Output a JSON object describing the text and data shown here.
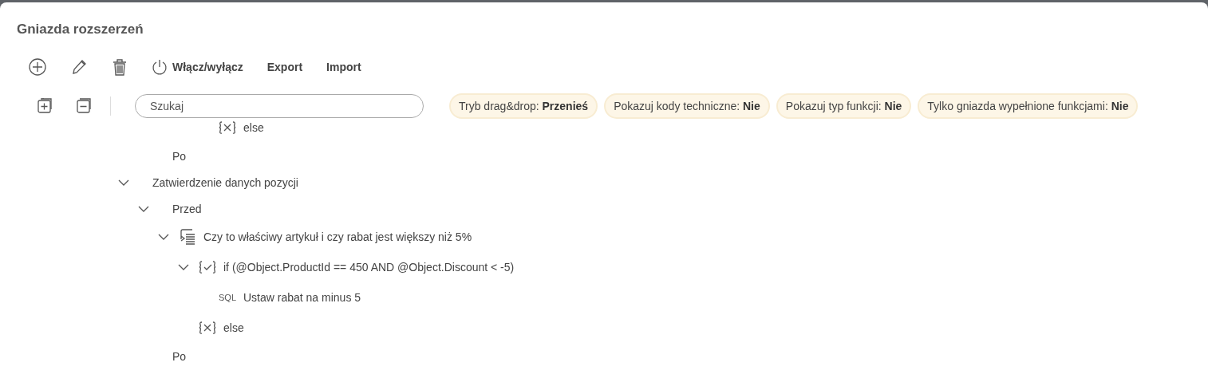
{
  "window": {
    "title": "Gniazda rozszerzeń"
  },
  "toolbar": [
    {
      "kind": "add"
    },
    {
      "kind": "edit"
    },
    {
      "kind": "delete"
    },
    {
      "kind": "power",
      "label": "Włącz/wyłącz"
    },
    {
      "kind": "text",
      "label": "Export"
    },
    {
      "kind": "text",
      "label": "Import"
    }
  ],
  "tree_tools": [
    {
      "kind": "expand-all"
    },
    {
      "kind": "collapse-all"
    }
  ],
  "search": {
    "placeholder": "Szukaj"
  },
  "filters": [
    {
      "label": "Tryb drag&drop:",
      "value": "Przenieś"
    },
    {
      "label": "Pokazuj kody techniczne:",
      "value": "Nie"
    },
    {
      "label": "Pokazuj typ funkcji:",
      "value": "Nie"
    },
    {
      "label": "Tylko gniazda wypełnione funkcjami:",
      "value": "Nie"
    }
  ],
  "tree": [
    {
      "children": [
        {
          "children": [
            {
              "children": [
                {
                  "children": [
                    {
                      "kind": "else",
                      "label": "else"
                    }
                  ]
                }
              ]
            }
          ]
        },
        {
          "label": "Po"
        }
      ]
    },
    {
      "label": "Zatwierdzenie danych pozycji",
      "expanded": true,
      "children": [
        {
          "label": "Przed",
          "expanded": true,
          "children": [
            {
              "kind": "function",
              "label": "Czy to właściwy artykuł i czy rabat jest większy niż 5%",
              "expanded": true,
              "children": [
                {
                  "kind": "if",
                  "label": "if (@Object.ProductId == 450 AND @Object.Discount < -5)",
                  "expanded": true,
                  "children": [
                    {
                      "kind": "sql",
                      "tag": "SQL",
                      "label": "Ustaw rabat na minus 5"
                    }
                  ]
                },
                {
                  "kind": "else",
                  "label": "else"
                }
              ]
            }
          ]
        },
        {
          "label": "Po"
        }
      ]
    }
  ]
}
